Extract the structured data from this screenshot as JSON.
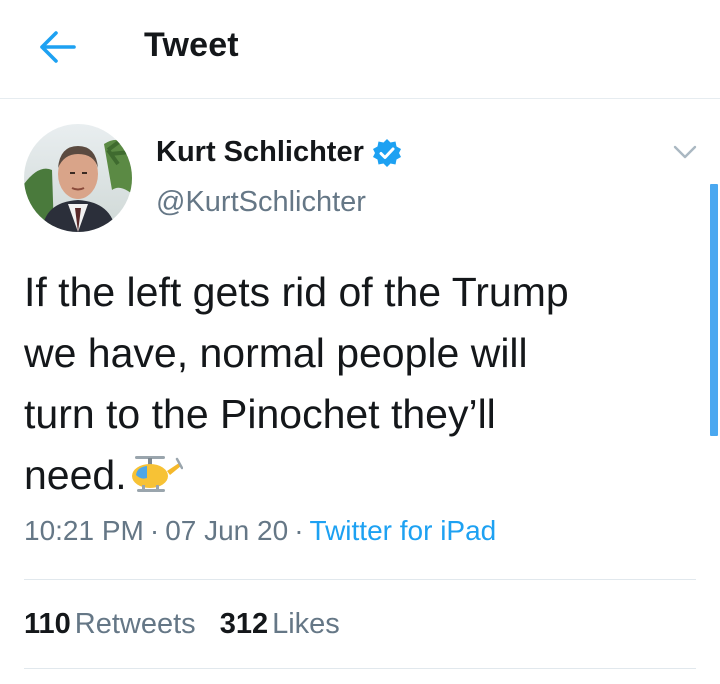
{
  "header": {
    "title": "Tweet",
    "back_icon": "arrow-left-icon"
  },
  "colors": {
    "accent": "#1da1f2",
    "muted": "#657786",
    "text": "#14171a",
    "divider": "#e1e8ed"
  },
  "author": {
    "name": "Kurt Schlichter",
    "handle": "@KurtSchlichter",
    "verified": true
  },
  "tweet": {
    "lines": [
      "If the left gets rid of the Trump",
      "we have, normal people will",
      "turn to the Pinochet they’ll",
      "need."
    ],
    "emoji": "helicopter"
  },
  "meta": {
    "time": "10:21 PM",
    "date": "07 Jun 20",
    "source": "Twitter for iPad",
    "separator": "·"
  },
  "stats": {
    "retweets_count": "110",
    "retweets_label": "Retweets",
    "likes_count": "312",
    "likes_label": "Likes"
  }
}
